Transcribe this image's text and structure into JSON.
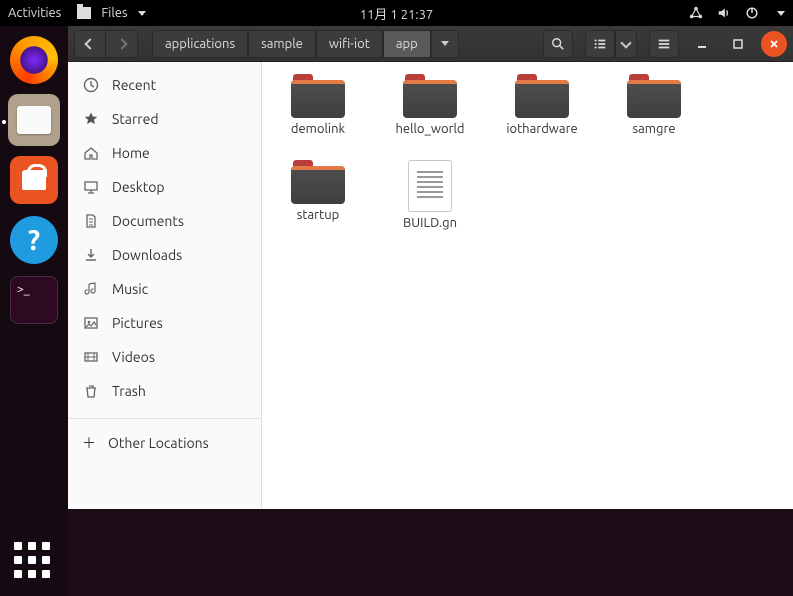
{
  "top_panel": {
    "activities": "Activities",
    "files_menu": "Files",
    "clock": "11月 1 21:37"
  },
  "dock": {
    "help_symbol": "?",
    "terminal_prompt": ">_"
  },
  "headerbar": {
    "path": [
      "applications",
      "sample",
      "wifi-iot",
      "app"
    ],
    "active_segment": 3
  },
  "sidebar": {
    "items": [
      {
        "icon": "clock",
        "label": "Recent"
      },
      {
        "icon": "star",
        "label": "Starred"
      },
      {
        "icon": "home",
        "label": "Home"
      },
      {
        "icon": "desktop",
        "label": "Desktop"
      },
      {
        "icon": "documents",
        "label": "Documents"
      },
      {
        "icon": "downloads",
        "label": "Downloads"
      },
      {
        "icon": "music",
        "label": "Music"
      },
      {
        "icon": "pictures",
        "label": "Pictures"
      },
      {
        "icon": "videos",
        "label": "Videos"
      },
      {
        "icon": "trash",
        "label": "Trash"
      }
    ],
    "other_locations": "Other Locations"
  },
  "content": {
    "items": [
      {
        "type": "folder",
        "name": "demolink"
      },
      {
        "type": "folder",
        "name": "hello_world"
      },
      {
        "type": "folder",
        "name": "iothardware"
      },
      {
        "type": "folder",
        "name": "samgre"
      },
      {
        "type": "folder",
        "name": "startup"
      },
      {
        "type": "file",
        "name": "BUILD.gn"
      }
    ]
  }
}
